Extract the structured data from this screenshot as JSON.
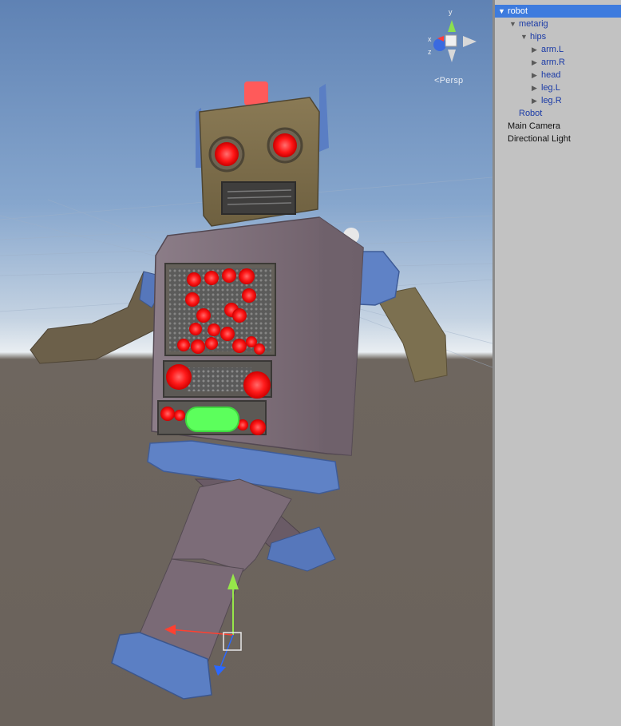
{
  "scene": {
    "projection_label": "<Persp",
    "gizmo_axes": [
      "x",
      "y",
      "z"
    ]
  },
  "hierarchy": {
    "items": [
      {
        "label": "robot",
        "depth": 0,
        "expanded": true,
        "selected": true,
        "color": "blue"
      },
      {
        "label": "metarig",
        "depth": 1,
        "expanded": true,
        "selected": false,
        "color": "blue"
      },
      {
        "label": "hips",
        "depth": 2,
        "expanded": true,
        "selected": false,
        "color": "blue"
      },
      {
        "label": "arm.L",
        "depth": 3,
        "expanded": false,
        "selected": false,
        "color": "blue"
      },
      {
        "label": "arm.R",
        "depth": 3,
        "expanded": false,
        "selected": false,
        "color": "blue"
      },
      {
        "label": "head",
        "depth": 3,
        "expanded": false,
        "selected": false,
        "color": "blue"
      },
      {
        "label": "leg.L",
        "depth": 3,
        "expanded": false,
        "selected": false,
        "color": "blue"
      },
      {
        "label": "leg.R",
        "depth": 3,
        "expanded": false,
        "selected": false,
        "color": "blue"
      },
      {
        "label": "Robot",
        "depth": 1,
        "expanded": null,
        "selected": false,
        "color": "blue"
      },
      {
        "label": "Main Camera",
        "depth": 0,
        "expanded": null,
        "selected": false,
        "color": "black"
      },
      {
        "label": "Directional Light",
        "depth": 0,
        "expanded": null,
        "selected": false,
        "color": "black"
      }
    ]
  },
  "colors": {
    "selection": "#3d7bde",
    "prefab_blue": "#1a3aa6",
    "led_red": "#ff1a1a",
    "led_green": "#5cff5c",
    "robot_body": "#7d6d76",
    "robot_accent": "#5b7fc4"
  }
}
